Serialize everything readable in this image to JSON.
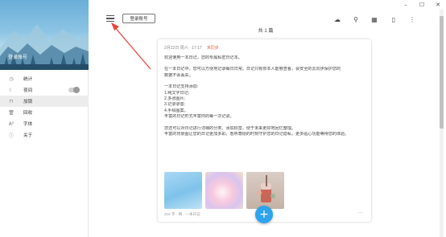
{
  "window": {
    "minimize_glyph": "–",
    "maximize_glyph": "☐",
    "close_glyph": "✕"
  },
  "sidebar": {
    "login_label": "登录账号",
    "items": [
      {
        "label": "统计",
        "icon": "clock-icon",
        "glyph": "◷"
      },
      {
        "label": "夜间",
        "icon": "moon-icon",
        "glyph": "☾",
        "toggle": false
      },
      {
        "label": "加锁",
        "icon": "lock-icon",
        "glyph": "⊓",
        "active": true
      },
      {
        "label": "回收",
        "icon": "trash-icon",
        "glyph": "🗑"
      },
      {
        "label": "字体",
        "icon": "font-icon",
        "glyph": "A²"
      },
      {
        "label": "关于",
        "icon": "info-icon",
        "glyph": "ⓘ"
      }
    ]
  },
  "toolbar": {
    "login_button": "登录账号",
    "count_label": "共 1 篇",
    "icons": [
      {
        "name": "cloud-upload-icon",
        "glyph": "☁"
      },
      {
        "name": "search-icon",
        "glyph": "⚲"
      },
      {
        "name": "calendar-icon",
        "glyph": "▦"
      },
      {
        "name": "bookmark-icon",
        "glyph": "▯"
      },
      {
        "name": "more-vertical-icon",
        "glyph": "⋮"
      }
    ]
  },
  "entry": {
    "date": "2月22日 周六 · 17:17",
    "location": "未同步",
    "lines": [
      "欢迎使用一本日记，您的专属私密日记本。",
      "",
      "在一本日记中，您可以方便地记录每日日常。日记只有你本人能够查看，会安全的云同步保护您的",
      "数据不会丢失。",
      "",
      "一本日记支持添加:",
      "1.纯文字日记;",
      "2.多张图片;",
      "3.记录录音;",
      "4.手绘图案。",
      "丰富的日记形式丰富你的每一次记录。",
      "",
      "您还可以对日记进行详细的分类、添加标签，便于未来更好地回忆整理。",
      "丰富的背景图让您的日记更加多彩。悉听尊便的时刻守护您的日记隐私，更多贴心功能等待您的体验。"
    ],
    "meta": "218 字 · 晴 · 一本日记",
    "more": "···"
  },
  "fab": {
    "label": "+"
  }
}
